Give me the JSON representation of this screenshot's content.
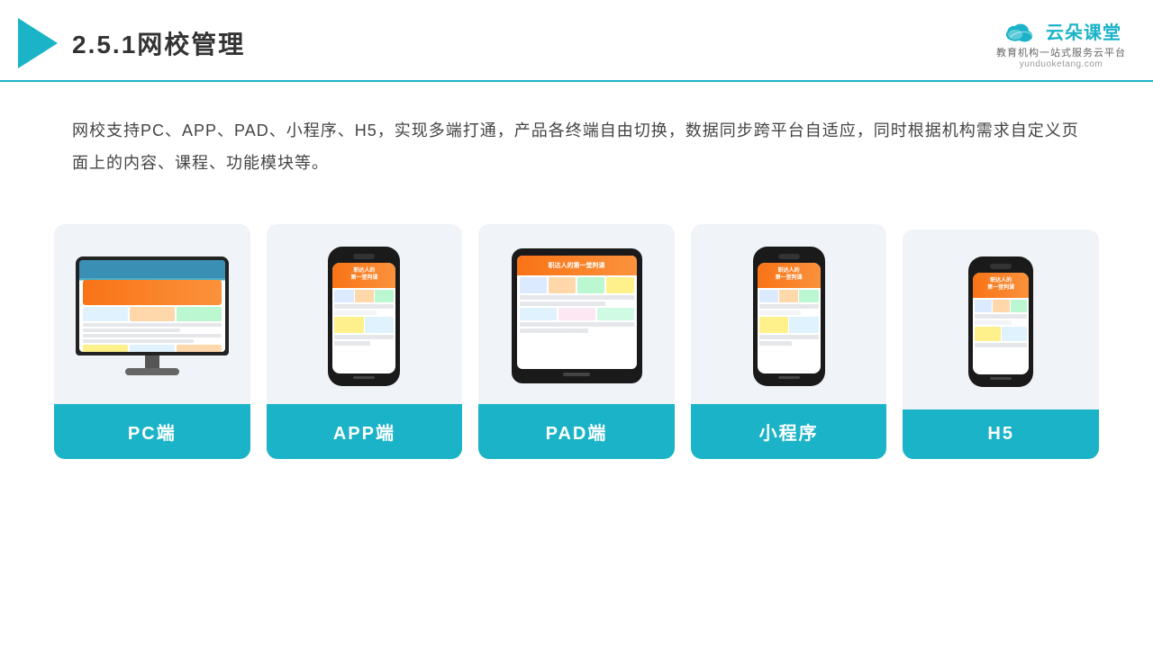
{
  "header": {
    "title": "2.5.1网校管理",
    "brand": {
      "name": "云朵课堂",
      "url": "yunduoketang.com",
      "tagline": "教育机构一站式服务云平台"
    }
  },
  "description": "网校支持PC、APP、PAD、小程序、H5，实现多端打通，产品各终端自由切换，数据同步跨平台自适应，同时根据机构需求自定义页面上的内容、课程、功能模块等。",
  "cards": [
    {
      "id": "pc",
      "label": "PC端"
    },
    {
      "id": "app",
      "label": "APP端"
    },
    {
      "id": "pad",
      "label": "PAD端"
    },
    {
      "id": "miniapp",
      "label": "小程序"
    },
    {
      "id": "h5",
      "label": "H5"
    }
  ],
  "colors": {
    "teal": "#1ab3c8",
    "orange": "#f97316"
  }
}
